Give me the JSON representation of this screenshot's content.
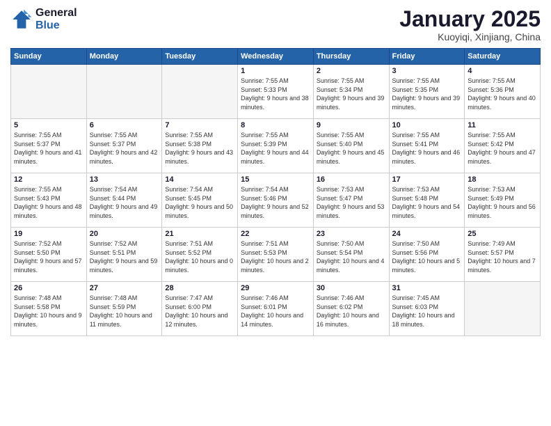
{
  "logo": {
    "line1": "General",
    "line2": "Blue"
  },
  "title": "January 2025",
  "subtitle": "Kuoyiqi, Xinjiang, China",
  "weekdays": [
    "Sunday",
    "Monday",
    "Tuesday",
    "Wednesday",
    "Thursday",
    "Friday",
    "Saturday"
  ],
  "weeks": [
    [
      {
        "day": "",
        "sunrise": "",
        "sunset": "",
        "daylight": ""
      },
      {
        "day": "",
        "sunrise": "",
        "sunset": "",
        "daylight": ""
      },
      {
        "day": "",
        "sunrise": "",
        "sunset": "",
        "daylight": ""
      },
      {
        "day": "1",
        "sunrise": "Sunrise: 7:55 AM",
        "sunset": "Sunset: 5:33 PM",
        "daylight": "Daylight: 9 hours and 38 minutes."
      },
      {
        "day": "2",
        "sunrise": "Sunrise: 7:55 AM",
        "sunset": "Sunset: 5:34 PM",
        "daylight": "Daylight: 9 hours and 39 minutes."
      },
      {
        "day": "3",
        "sunrise": "Sunrise: 7:55 AM",
        "sunset": "Sunset: 5:35 PM",
        "daylight": "Daylight: 9 hours and 39 minutes."
      },
      {
        "day": "4",
        "sunrise": "Sunrise: 7:55 AM",
        "sunset": "Sunset: 5:36 PM",
        "daylight": "Daylight: 9 hours and 40 minutes."
      }
    ],
    [
      {
        "day": "5",
        "sunrise": "Sunrise: 7:55 AM",
        "sunset": "Sunset: 5:37 PM",
        "daylight": "Daylight: 9 hours and 41 minutes."
      },
      {
        "day": "6",
        "sunrise": "Sunrise: 7:55 AM",
        "sunset": "Sunset: 5:37 PM",
        "daylight": "Daylight: 9 hours and 42 minutes."
      },
      {
        "day": "7",
        "sunrise": "Sunrise: 7:55 AM",
        "sunset": "Sunset: 5:38 PM",
        "daylight": "Daylight: 9 hours and 43 minutes."
      },
      {
        "day": "8",
        "sunrise": "Sunrise: 7:55 AM",
        "sunset": "Sunset: 5:39 PM",
        "daylight": "Daylight: 9 hours and 44 minutes."
      },
      {
        "day": "9",
        "sunrise": "Sunrise: 7:55 AM",
        "sunset": "Sunset: 5:40 PM",
        "daylight": "Daylight: 9 hours and 45 minutes."
      },
      {
        "day": "10",
        "sunrise": "Sunrise: 7:55 AM",
        "sunset": "Sunset: 5:41 PM",
        "daylight": "Daylight: 9 hours and 46 minutes."
      },
      {
        "day": "11",
        "sunrise": "Sunrise: 7:55 AM",
        "sunset": "Sunset: 5:42 PM",
        "daylight": "Daylight: 9 hours and 47 minutes."
      }
    ],
    [
      {
        "day": "12",
        "sunrise": "Sunrise: 7:55 AM",
        "sunset": "Sunset: 5:43 PM",
        "daylight": "Daylight: 9 hours and 48 minutes."
      },
      {
        "day": "13",
        "sunrise": "Sunrise: 7:54 AM",
        "sunset": "Sunset: 5:44 PM",
        "daylight": "Daylight: 9 hours and 49 minutes."
      },
      {
        "day": "14",
        "sunrise": "Sunrise: 7:54 AM",
        "sunset": "Sunset: 5:45 PM",
        "daylight": "Daylight: 9 hours and 50 minutes."
      },
      {
        "day": "15",
        "sunrise": "Sunrise: 7:54 AM",
        "sunset": "Sunset: 5:46 PM",
        "daylight": "Daylight: 9 hours and 52 minutes."
      },
      {
        "day": "16",
        "sunrise": "Sunrise: 7:53 AM",
        "sunset": "Sunset: 5:47 PM",
        "daylight": "Daylight: 9 hours and 53 minutes."
      },
      {
        "day": "17",
        "sunrise": "Sunrise: 7:53 AM",
        "sunset": "Sunset: 5:48 PM",
        "daylight": "Daylight: 9 hours and 54 minutes."
      },
      {
        "day": "18",
        "sunrise": "Sunrise: 7:53 AM",
        "sunset": "Sunset: 5:49 PM",
        "daylight": "Daylight: 9 hours and 56 minutes."
      }
    ],
    [
      {
        "day": "19",
        "sunrise": "Sunrise: 7:52 AM",
        "sunset": "Sunset: 5:50 PM",
        "daylight": "Daylight: 9 hours and 57 minutes."
      },
      {
        "day": "20",
        "sunrise": "Sunrise: 7:52 AM",
        "sunset": "Sunset: 5:51 PM",
        "daylight": "Daylight: 9 hours and 59 minutes."
      },
      {
        "day": "21",
        "sunrise": "Sunrise: 7:51 AM",
        "sunset": "Sunset: 5:52 PM",
        "daylight": "Daylight: 10 hours and 0 minutes."
      },
      {
        "day": "22",
        "sunrise": "Sunrise: 7:51 AM",
        "sunset": "Sunset: 5:53 PM",
        "daylight": "Daylight: 10 hours and 2 minutes."
      },
      {
        "day": "23",
        "sunrise": "Sunrise: 7:50 AM",
        "sunset": "Sunset: 5:54 PM",
        "daylight": "Daylight: 10 hours and 4 minutes."
      },
      {
        "day": "24",
        "sunrise": "Sunrise: 7:50 AM",
        "sunset": "Sunset: 5:56 PM",
        "daylight": "Daylight: 10 hours and 5 minutes."
      },
      {
        "day": "25",
        "sunrise": "Sunrise: 7:49 AM",
        "sunset": "Sunset: 5:57 PM",
        "daylight": "Daylight: 10 hours and 7 minutes."
      }
    ],
    [
      {
        "day": "26",
        "sunrise": "Sunrise: 7:48 AM",
        "sunset": "Sunset: 5:58 PM",
        "daylight": "Daylight: 10 hours and 9 minutes."
      },
      {
        "day": "27",
        "sunrise": "Sunrise: 7:48 AM",
        "sunset": "Sunset: 5:59 PM",
        "daylight": "Daylight: 10 hours and 11 minutes."
      },
      {
        "day": "28",
        "sunrise": "Sunrise: 7:47 AM",
        "sunset": "Sunset: 6:00 PM",
        "daylight": "Daylight: 10 hours and 12 minutes."
      },
      {
        "day": "29",
        "sunrise": "Sunrise: 7:46 AM",
        "sunset": "Sunset: 6:01 PM",
        "daylight": "Daylight: 10 hours and 14 minutes."
      },
      {
        "day": "30",
        "sunrise": "Sunrise: 7:46 AM",
        "sunset": "Sunset: 6:02 PM",
        "daylight": "Daylight: 10 hours and 16 minutes."
      },
      {
        "day": "31",
        "sunrise": "Sunrise: 7:45 AM",
        "sunset": "Sunset: 6:03 PM",
        "daylight": "Daylight: 10 hours and 18 minutes."
      },
      {
        "day": "",
        "sunrise": "",
        "sunset": "",
        "daylight": ""
      }
    ]
  ]
}
